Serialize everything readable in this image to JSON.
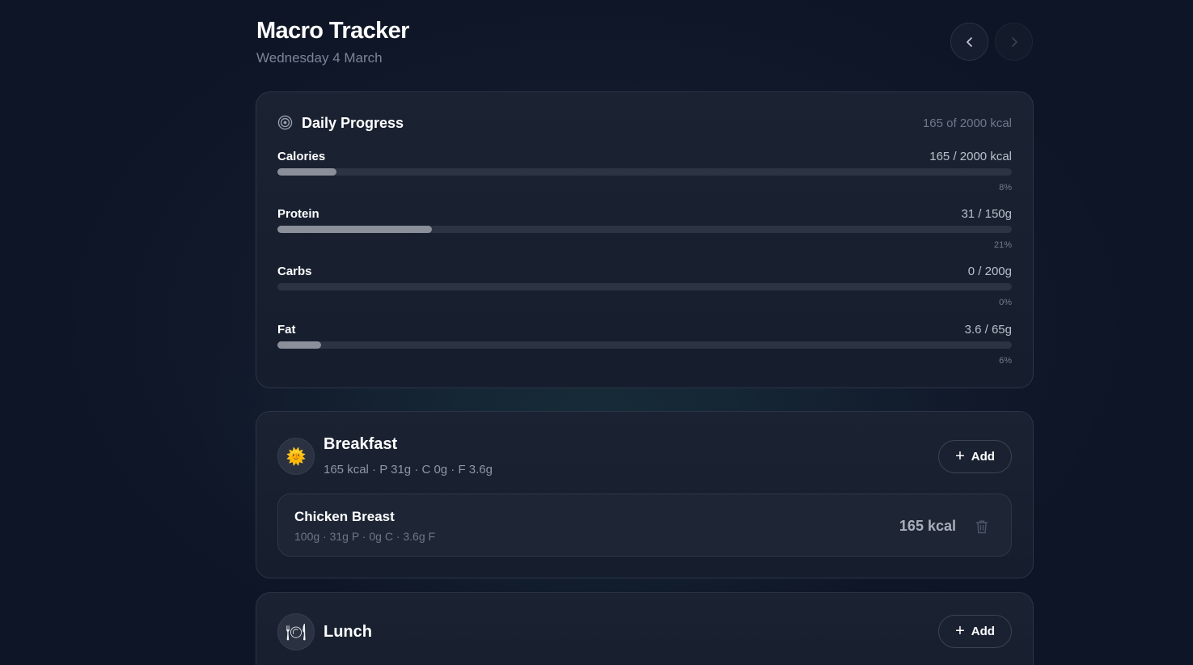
{
  "header": {
    "title": "Macro Tracker",
    "date": "Wednesday 4 March",
    "prev_icon": "chevron-left-icon",
    "next_icon": "chevron-right-icon"
  },
  "daily_progress": {
    "title": "Daily Progress",
    "icon": "target-icon",
    "summary": "165 of 2000 kcal",
    "macros": [
      {
        "name": "Calories",
        "value": "165 / 2000 kcal",
        "percent_label": "8%",
        "percent": 8
      },
      {
        "name": "Protein",
        "value": "31 / 150g",
        "percent_label": "21%",
        "percent": 21
      },
      {
        "name": "Carbs",
        "value": "0 / 200g",
        "percent_label": "0%",
        "percent": 0
      },
      {
        "name": "Fat",
        "value": "3.6 / 65g",
        "percent_label": "6%",
        "percent": 6
      }
    ]
  },
  "meals": [
    {
      "name": "Breakfast",
      "icon": "sun-icon",
      "icon_glyph": "🌞",
      "summary": "165 kcal · P 31g · C 0g · F 3.6g",
      "add_label": "Add",
      "items": [
        {
          "name": "Chicken Breast",
          "details": "100g · 31g P · 0g C · 3.6g F",
          "kcal": "165 kcal"
        }
      ]
    },
    {
      "name": "Lunch",
      "icon": "plate-icon",
      "icon_glyph": "🍽",
      "add_label": "Add"
    }
  ],
  "colors": {
    "background": "#0e1526",
    "card": "#1b2333",
    "bar_fill": "#8a8f99",
    "bar_track": "#2c3444"
  }
}
